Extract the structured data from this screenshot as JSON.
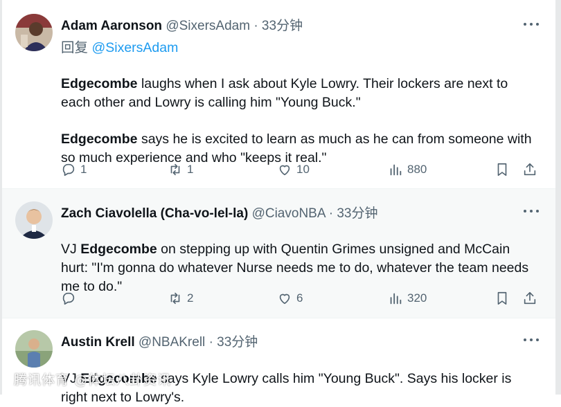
{
  "tweets": [
    {
      "name": "Adam Aaronson",
      "handle": "@SixersAdam",
      "time": "· 33分钟",
      "reply_prefix": "回复",
      "reply_handle": "@SixersAdam",
      "para1_bold": "Edgecombe",
      "para1_rest": " laughs when I ask about Kyle Lowry. Their lockers are next to each other and Lowry is calling him \"Young Buck.\"",
      "para2_bold": "Edgecombe",
      "para2_rest": " says he is excited to learn as much as he can from someone with so much experience and who \"keeps it real.\"",
      "replies": "1",
      "reposts": "1",
      "likes": "10",
      "views": "880"
    },
    {
      "name": "Zach Ciavolella (Cha-vo-lel-la)",
      "handle": "@CiavoNBA",
      "time": "· 33分钟",
      "pre": "VJ ",
      "bold": "Edgecombe",
      "rest": " on stepping up with Quentin Grimes unsigned and McCain hurt: \"I'm gonna do whatever Nurse needs me to do, whatever the team needs me to do.\"",
      "replies": "",
      "reposts": "2",
      "likes": "6",
      "views": "320"
    },
    {
      "name": "Austin Krell",
      "handle": "@NBAKrell",
      "time": "· 33分钟",
      "pre": "VJ ",
      "bold": "Edgecombe",
      "rest": " says Kyle Lowry calls him \"Young Buck\". Says his locker is right next to Lowry's."
    }
  ],
  "watermark": "腾讯体育 @体坛八卦资讯",
  "icons": [
    "more-icon",
    "reply-icon",
    "repost-icon",
    "like-icon",
    "views-icon",
    "bookmark-icon",
    "share-icon"
  ],
  "colors": {
    "text": "#0f1419",
    "muted": "#536471",
    "link": "#1d9bf0",
    "highlight_bg": "#f7f9f9"
  }
}
